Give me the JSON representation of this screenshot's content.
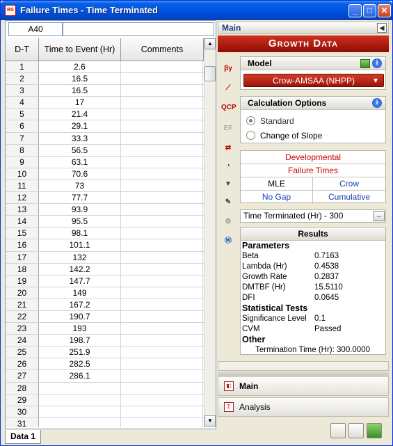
{
  "window": {
    "title": "Failure Times - Time Terminated",
    "minimize": "_",
    "maximize": "□",
    "close": "✕",
    "app_icon": "RS"
  },
  "grid": {
    "cell_ref": "A40",
    "formula": "",
    "headers": {
      "row": "D-T",
      "value": "Time to Event (Hr)",
      "comments": "Comments"
    },
    "rows": [
      {
        "n": "1",
        "v": "2.6"
      },
      {
        "n": "2",
        "v": "16.5"
      },
      {
        "n": "3",
        "v": "16.5"
      },
      {
        "n": "4",
        "v": "17"
      },
      {
        "n": "5",
        "v": "21.4"
      },
      {
        "n": "6",
        "v": "29.1"
      },
      {
        "n": "7",
        "v": "33.3"
      },
      {
        "n": "8",
        "v": "56.5"
      },
      {
        "n": "9",
        "v": "63.1"
      },
      {
        "n": "10",
        "v": "70.6"
      },
      {
        "n": "11",
        "v": "73"
      },
      {
        "n": "12",
        "v": "77.7"
      },
      {
        "n": "13",
        "v": "93.9"
      },
      {
        "n": "14",
        "v": "95.5"
      },
      {
        "n": "15",
        "v": "98.1"
      },
      {
        "n": "16",
        "v": "101.1"
      },
      {
        "n": "17",
        "v": "132"
      },
      {
        "n": "18",
        "v": "142.2"
      },
      {
        "n": "19",
        "v": "147.7"
      },
      {
        "n": "20",
        "v": "149"
      },
      {
        "n": "21",
        "v": "167.2"
      },
      {
        "n": "22",
        "v": "190.7"
      },
      {
        "n": "23",
        "v": "193"
      },
      {
        "n": "24",
        "v": "198.7"
      },
      {
        "n": "25",
        "v": "251.9"
      },
      {
        "n": "26",
        "v": "282.5"
      },
      {
        "n": "27",
        "v": "286.1"
      },
      {
        "n": "28",
        "v": ""
      },
      {
        "n": "29",
        "v": ""
      },
      {
        "n": "30",
        "v": ""
      },
      {
        "n": "31",
        "v": ""
      }
    ],
    "sheet_tab": "Data 1"
  },
  "panel": {
    "header": "Main",
    "banner": "Growth Data",
    "model": {
      "title": "Model",
      "selected": "Crow-AMSAA (NHPP)"
    },
    "calc": {
      "title": "Calculation Options",
      "options": [
        "Standard",
        "Change of Slope"
      ],
      "selected": "Standard"
    },
    "settings": {
      "developmental": "Developmental",
      "failure_times": "Failure Times",
      "mle": "MLE",
      "crow": "Crow",
      "no_gap": "No Gap",
      "cumulative": "Cumulative"
    },
    "time_terminated": "Time Terminated (Hr) - 300",
    "results": {
      "title": "Results",
      "parameters_label": "Parameters",
      "parameters": [
        {
          "k": "Beta",
          "v": "0.7163"
        },
        {
          "k": "Lambda (Hr)",
          "v": "0.4538"
        },
        {
          "k": "Growth Rate",
          "v": "0.2837"
        },
        {
          "k": "DMTBF (Hr)",
          "v": "15.5110"
        },
        {
          "k": "DFI",
          "v": "0.0645"
        }
      ],
      "stats_label": "Statistical Tests",
      "stats": [
        {
          "k": "Significance Level",
          "v": "0.1"
        },
        {
          "k": "CVM",
          "v": "Passed"
        }
      ],
      "other_label": "Other",
      "termination": "Termination Time (Hr): 300.0000"
    },
    "nav": {
      "main": "Main",
      "analysis": "Analysis"
    },
    "colors": {
      "accent_red": "#c00000",
      "accent_blue": "#1a3fb8"
    }
  }
}
